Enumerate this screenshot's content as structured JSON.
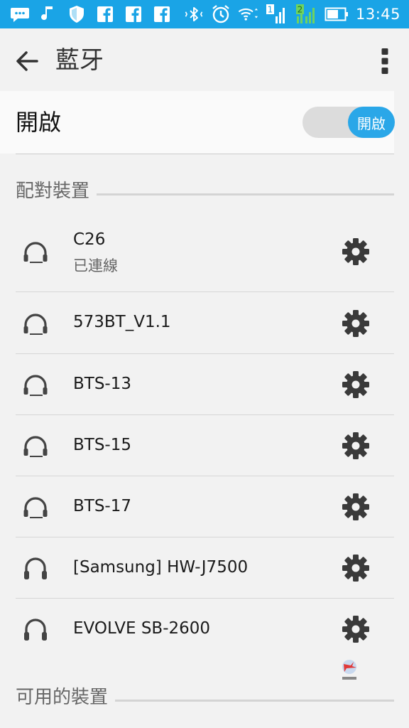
{
  "status_bar": {
    "time": "13:45",
    "icons": [
      "chat-icon",
      "music-icon",
      "shield-icon",
      "facebook-icon",
      "facebook-icon",
      "facebook-icon",
      "bluetooth-icon",
      "alarm-icon",
      "wifi-icon",
      "signal-sim1-icon",
      "signal-sim2-icon",
      "battery-icon"
    ],
    "sim1_label": "1",
    "sim2_label": "2"
  },
  "appbar": {
    "title": "藍牙"
  },
  "bluetooth_toggle": {
    "label": "開啟",
    "state_label": "開啟",
    "on": true
  },
  "paired_section": {
    "title": "配對裝置",
    "devices": [
      {
        "name": "C26",
        "status": "已連線"
      },
      {
        "name": "573BT_V1.1",
        "status": ""
      },
      {
        "name": "BTS-13",
        "status": ""
      },
      {
        "name": "BTS-15",
        "status": ""
      },
      {
        "name": "BTS-17",
        "status": ""
      },
      {
        "name": "[Samsung] HW-J7500",
        "status": ""
      },
      {
        "name": "EVOLVE SB-2600",
        "status": ""
      }
    ]
  },
  "available_section": {
    "title": "可用的裝置"
  },
  "colors": {
    "status_bar": "#1aa4e6",
    "accent": "#2aa7e8",
    "background": "#f2f2f2"
  }
}
